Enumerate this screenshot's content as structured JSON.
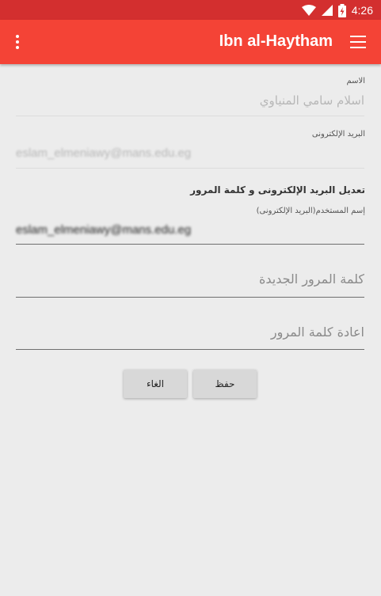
{
  "status_bar": {
    "time": "4:26",
    "icons": [
      "wifi-icon",
      "signal-icon",
      "battery-icon"
    ]
  },
  "app_bar": {
    "title": "Ibn al-Haytham",
    "overflow_icon": "more-vert-icon",
    "menu_icon": "menu-icon",
    "color": "#f44336",
    "status_color": "#d32f2f"
  },
  "form": {
    "name_label": "الاسم",
    "name_value": "اسلام سامي المنياوي",
    "email_label": "البريد الإلكترونى",
    "email_value": "eslam_elmeniawy@mans.edu.eg",
    "section_title": "تعديل البريد الإلكترونى و كلمة المرور",
    "username_label": "إسم المستخدم(البريد الإلكترونى)",
    "username_value": "eslam_elmeniawy@mans.edu.eg",
    "new_password_placeholder": "كلمة  المرور  الجديدة",
    "confirm_password_placeholder": "اعادة  كلمة  المرور"
  },
  "buttons": {
    "save_label": "حفظ",
    "cancel_label": "الغاء"
  }
}
